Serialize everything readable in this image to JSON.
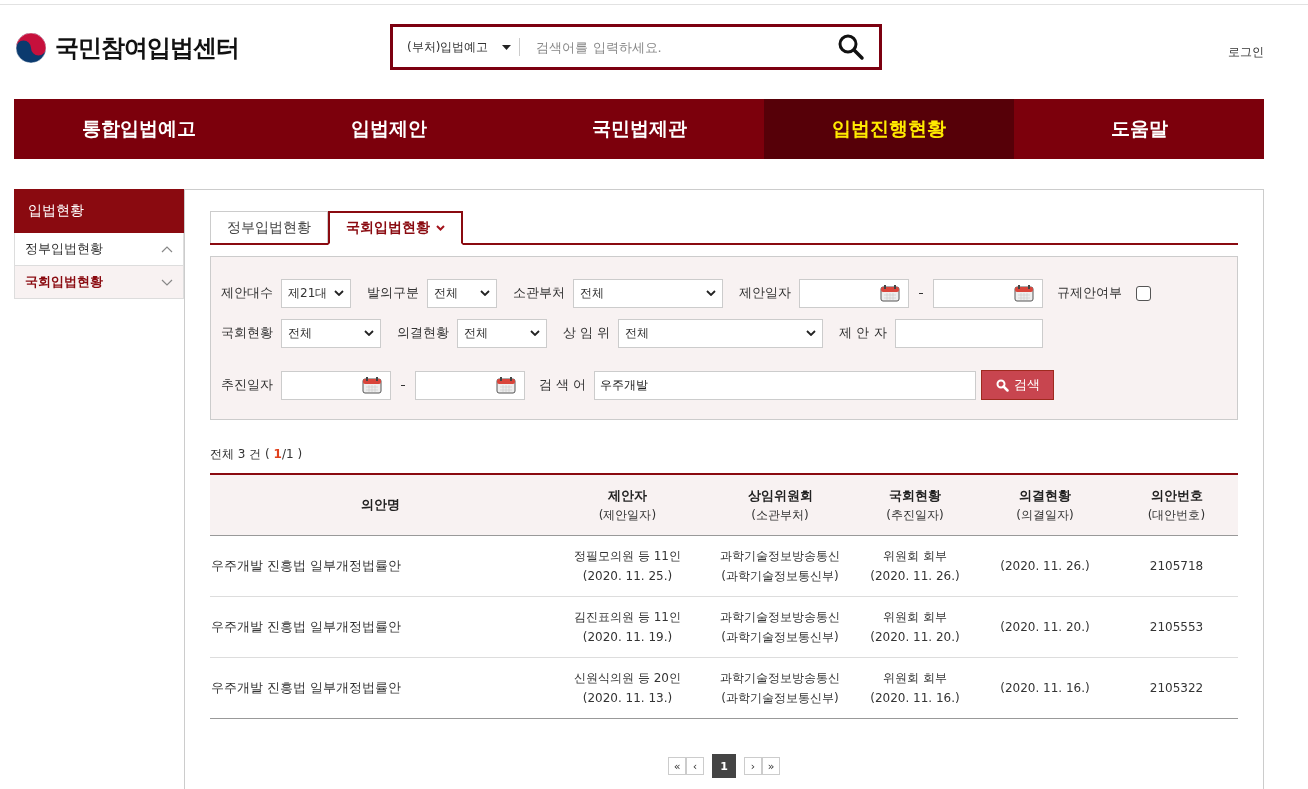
{
  "header": {
    "site_title": "국민참여입법센터",
    "search": {
      "scope": "(부처)입법예고",
      "placeholder": "검색어를 입력하세요."
    },
    "login": "로그인"
  },
  "nav": [
    {
      "label": "통합입법예고",
      "selected": false
    },
    {
      "label": "입법제안",
      "selected": false
    },
    {
      "label": "국민법제관",
      "selected": false
    },
    {
      "label": "입법진행현황",
      "selected": true
    },
    {
      "label": "도움말",
      "selected": false
    }
  ],
  "sidebar": {
    "title": "입법현황",
    "items": [
      {
        "label": "정부입법현황",
        "selected": false,
        "expanded": true
      },
      {
        "label": "국회입법현황",
        "selected": true,
        "expanded": false
      }
    ]
  },
  "tabs": [
    {
      "label": "정부입법현황",
      "selected": false
    },
    {
      "label": "국회입법현황",
      "selected": true
    }
  ],
  "filters": [
    [
      {
        "label": "제안대수",
        "kind": "select",
        "value": "제21대"
      },
      {
        "label": "발의구분",
        "kind": "select",
        "value": "전체"
      },
      {
        "label": "소관부처",
        "kind": "select",
        "value": "전체"
      },
      {
        "label": "제안일자",
        "kind": "date-range"
      },
      {
        "label": "규제안여부",
        "kind": "checkbox",
        "checked": false
      }
    ],
    [
      {
        "label": "국회현황",
        "kind": "select",
        "value": "전체"
      },
      {
        "label": "의결현황",
        "kind": "select",
        "value": "전체"
      },
      {
        "label": "상 임 위",
        "kind": "select",
        "value": "전체"
      },
      {
        "label": "제 안 자",
        "kind": "text"
      }
    ],
    [
      {
        "label": "추진일자",
        "kind": "date-range"
      },
      {
        "label": "검 색 어",
        "kind": "text",
        "value": "우주개발"
      },
      {
        "kind": "button",
        "label": "검색"
      }
    ]
  ],
  "result_count": "전체 3 건 ( **1**/1 )",
  "table": {
    "columns": [
      {
        "title": "의안명"
      },
      {
        "title": "제안자",
        "subtitle": "(제안일자)"
      },
      {
        "title": "상임위원회",
        "subtitle": "(소관부처)"
      },
      {
        "title": "국회현황",
        "subtitle": "(추진일자)"
      },
      {
        "title": "의결현황",
        "subtitle": "(의결일자)"
      },
      {
        "title": "의안번호",
        "subtitle": "(대안번호)"
      }
    ],
    "rows": [
      [
        [
          "우주개발 진흥법 일부개정법률안"
        ],
        [
          "정필모의원 등 11인",
          "(2020. 11. 25.)"
        ],
        [
          "과학기술정보방송통신",
          "(과학기술정보통신부)"
        ],
        [
          "위원회 회부",
          "(2020. 11. 26.)"
        ],
        [
          "(2020. 11. 26.)"
        ],
        [
          "2105718"
        ]
      ],
      [
        [
          "우주개발 진흥법 일부개정법률안"
        ],
        [
          "김진표의원 등 11인",
          "(2020. 11. 19.)"
        ],
        [
          "과학기술정보방송통신",
          "(과학기술정보통신부)"
        ],
        [
          "위원회 회부",
          "(2020. 11. 20.)"
        ],
        [
          "(2020. 11. 20.)"
        ],
        [
          "2105553"
        ]
      ],
      [
        [
          "우주개발 진흥법 일부개정법률안"
        ],
        [
          "신원식의원 등 20인",
          "(2020. 11. 13.)"
        ],
        [
          "과학기술정보방송통신",
          "(과학기술정보통신부)"
        ],
        [
          "위원회 회부",
          "(2020. 11. 16.)"
        ],
        [
          "(2020. 11. 16.)"
        ],
        [
          "2105322"
        ]
      ]
    ]
  },
  "pagination": {
    "prev": [
      "«",
      "‹"
    ],
    "pages": [
      {
        "label": "1",
        "selected": true
      }
    ],
    "next": [
      "›",
      "»"
    ]
  }
}
